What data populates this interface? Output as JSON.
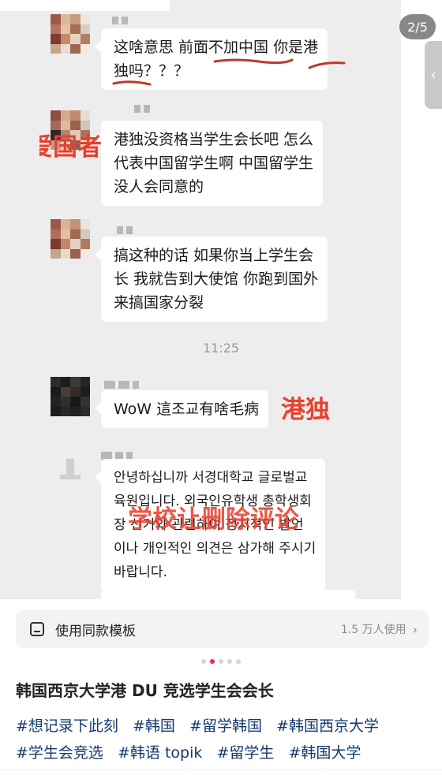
{
  "image_counter": "2/5",
  "chat": {
    "messages": [
      {
        "lines": [
          "这啥意思 前面不加中国 你是港",
          "独吗？？？"
        ]
      },
      {
        "lines": [
          "港独没资格当学生会长吧 怎么",
          "代表中国留学生啊 中国留学生",
          "没人会同意的"
        ]
      },
      {
        "lines": [
          "搞这种的话 如果你当上学生会",
          "长 我就告到大使馆 你跑到国外",
          "来搞国家分裂"
        ]
      },
      {
        "lines": [
          "WoW 這조교有啥毛病"
        ]
      },
      {
        "lines": [
          "안녕하십니까 서경대학교 글로벌교",
          "육원입니다. 외국인유학생 총학생회",
          "장 선거와 관련하여 정치적인 발언",
          "이나 개인적인 의견은 삼가해 주시기",
          "바랍니다."
        ]
      }
    ],
    "time_divider": "11:25",
    "labels": {
      "label_1": "爱国者",
      "label_2": "港独",
      "label_3": "学校让删除评论"
    }
  },
  "template": {
    "label": "使用同款模板",
    "count": "1.5 万人使用",
    "icon": "template-icon"
  },
  "post": {
    "title": "韩国西京大学港 DU 竞选学生会会长",
    "tags": [
      "#想记录下此刻",
      "#韩国",
      "#留学韩国",
      "#韩国西京大学",
      "#学生会竞选",
      "#韩语 topik",
      "#留学生",
      "#韩国大学"
    ]
  },
  "colors": {
    "annotation_red": "#e8402f",
    "tag_blue": "#13386c",
    "active_dot": "#ff2442"
  }
}
